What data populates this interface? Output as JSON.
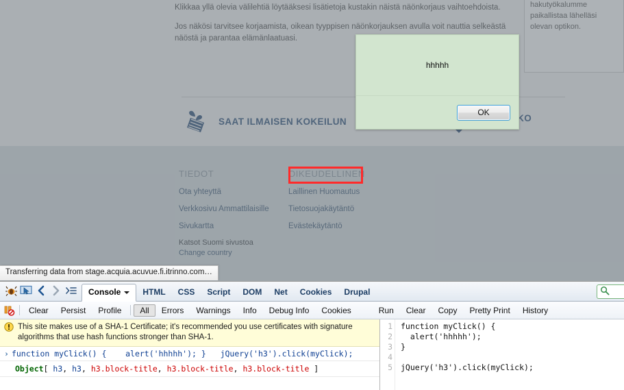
{
  "page": {
    "copy1": "Klikkaa yllä olevia välilehtiä löytääksesi lisätietoja kustakin näistä näönkorjaus vaihtoehdoista.",
    "copy2": "Jos näkösi tarvitsee korjaamista, oikean tyyppisen näönkorjauksen avulla voit nauttia selkeästä näöstä ja parantaa elämänlaatuasi.",
    "side_card": "tai ostaa ACUVUE® -piilolinssejä? Meidän hakutyökalumme paikallistaa lähelläsi olevan optikon.",
    "promo_label": "SAAT ILMAISEN KOKEILUN",
    "promo_label_2": "KKO",
    "gift_icon": "gift-icon",
    "footer": {
      "col1": {
        "heading": "TIEDOT",
        "links": [
          "Ota yhteyttä",
          "Verkkosivu Ammattilaisille",
          "Sivukartta"
        ]
      },
      "col2": {
        "heading": "OIKEUDELLINEN",
        "links": [
          "Laillinen Huomautus",
          "Tietosuojakäytäntö",
          "Evästekäytäntö"
        ]
      },
      "extra_line1": "Katsot Suomi sivustoa",
      "extra_line2": "Change country"
    },
    "inspect_highlight_color": "#ff2a2a"
  },
  "alert": {
    "message": "hhhhh",
    "ok_label": "OK",
    "background": "#d2e5cf"
  },
  "status_tip": {
    "text": "Transferring data from stage.acquia.acuvue.fi.itrinno.com…"
  },
  "firebug": {
    "icons": [
      {
        "name": "firebug-bug-icon"
      },
      {
        "name": "inspect-element-icon"
      },
      {
        "name": "back-arrow-icon"
      },
      {
        "name": "forward-arrow-icon"
      },
      {
        "name": "panel-list-icon"
      }
    ],
    "tabs": [
      {
        "label": "Console",
        "active": true,
        "has_caret": true
      },
      {
        "label": "HTML",
        "active": false
      },
      {
        "label": "CSS",
        "active": false
      },
      {
        "label": "Script",
        "active": false
      },
      {
        "label": "DOM",
        "active": false
      },
      {
        "label": "Net",
        "active": false
      },
      {
        "label": "Cookies",
        "active": false
      },
      {
        "label": "Drupal",
        "active": false
      }
    ],
    "search_icon": "search-icon",
    "subtoolbar": {
      "break_on_error_icon": "break-on-error-icon",
      "left_group": [
        "Clear",
        "Persist",
        "Profile"
      ],
      "filters": [
        {
          "label": "All",
          "pressed": true
        },
        {
          "label": "Errors",
          "pressed": false
        },
        {
          "label": "Warnings",
          "pressed": false
        },
        {
          "label": "Info",
          "pressed": false
        },
        {
          "label": "Debug Info",
          "pressed": false
        },
        {
          "label": "Cookies",
          "pressed": false
        }
      ],
      "right_group": [
        "Run",
        "Clear",
        "Copy",
        "Pretty Print",
        "History"
      ]
    },
    "console": {
      "warning_icon": "warning-icon",
      "warning_text": "This site makes use of a SHA-1 Certificate; it's recommended you use certificates with signature algorithms that use hash functions stronger than SHA-1.",
      "command_chevron": "›",
      "command_echo": "function myClick() {    alert('hhhhh'); }   jQuery('h3').click(myClick);",
      "result": {
        "type": "Object",
        "open_bracket": "[ ",
        "items": [
          "h3",
          "h3",
          "h3.block-title",
          "h3.block-title",
          "h3.block-title"
        ],
        "close_bracket": " ]"
      }
    },
    "command_editor": {
      "line_numbers": [
        "1",
        "2",
        "3",
        "4",
        "5"
      ],
      "lines": [
        "function myClick() {",
        "  alert('hhhhh');",
        "}",
        "",
        "jQuery('h3').click(myClick);"
      ]
    }
  }
}
